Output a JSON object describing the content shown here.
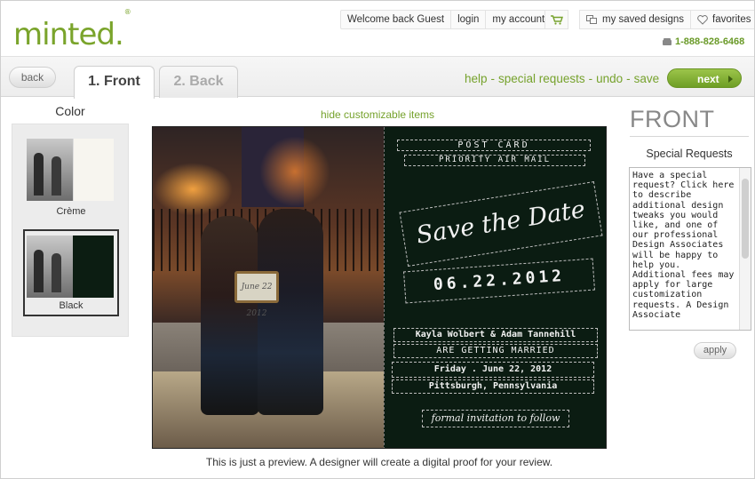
{
  "brand": {
    "logo_text": "minted.",
    "registered_mark": "®",
    "accent": "#7aa42b"
  },
  "topnav": {
    "welcome": "Welcome back Guest",
    "login": "login",
    "account": "my account",
    "saved_designs": "my saved designs",
    "favorites": "favorites",
    "phone": "1-888-828-6468"
  },
  "toolbar": {
    "back_label": "back",
    "tabs": [
      {
        "label": "1. Front",
        "active": true
      },
      {
        "label": "2. Back",
        "active": false
      }
    ],
    "actions": [
      "help",
      "special requests",
      "undo",
      "save"
    ],
    "separator": "-",
    "next_label": "next"
  },
  "color_panel": {
    "title": "Color",
    "options": [
      {
        "label": "Crème",
        "selected": false
      },
      {
        "label": "Black",
        "selected": true
      }
    ]
  },
  "preview": {
    "hide_link": "hide customizable items",
    "sign_text": "June 22 2012",
    "card": {
      "postcard": "POST CARD",
      "air_mail": "PRIORITY  AIR MAIL",
      "save_the_date": "Save the Date",
      "date": "06.22.2012",
      "names": "Kayla Wolbert & Adam Tannehill",
      "getting_married": "ARE GETTING MARRIED",
      "when": "Friday . June 22, 2012",
      "where": "Pittsburgh, Pennsylvania",
      "formal": "formal invitation to follow"
    },
    "note": "This is just a preview. A designer will create a digital proof for your review."
  },
  "side_panel": {
    "title": "FRONT",
    "requests_label": "Special Requests",
    "requests_text": "Have a special request? Click here to describe additional design tweaks you would like, and one of our professional Design Associates will be happy to help you. Additional fees may apply for large customization requests. A Design Associate",
    "apply_label": "apply"
  }
}
